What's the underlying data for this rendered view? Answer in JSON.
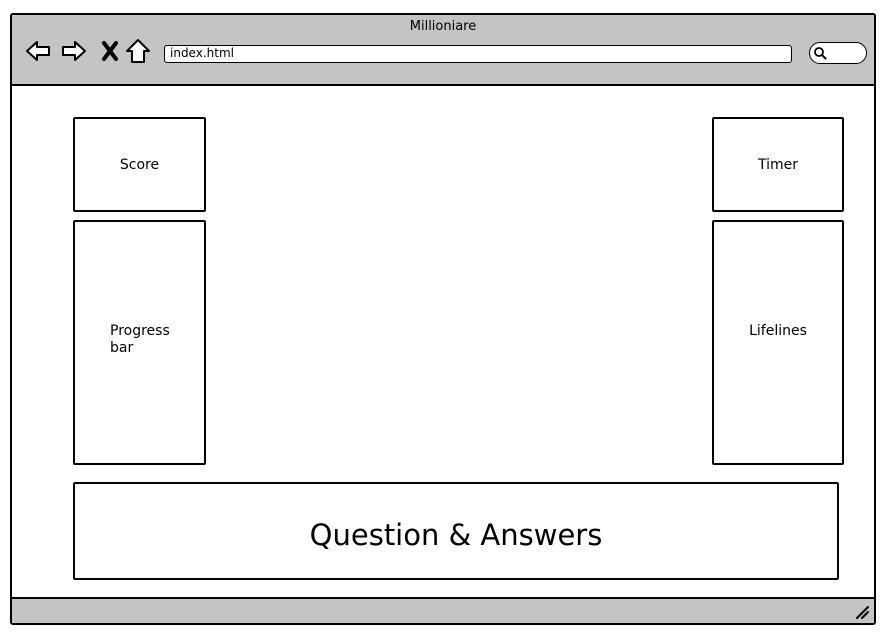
{
  "window": {
    "title": "Millioniare"
  },
  "toolbar": {
    "back_icon": "back-arrow-icon",
    "forward_icon": "forward-arrow-icon",
    "stop_icon": "close-x-icon",
    "home_icon": "home-icon",
    "address": "index.html",
    "search_icon": "search-icon"
  },
  "panels": {
    "score": "Score",
    "timer": "Timer",
    "progress": "Progress bar",
    "lifelines": "Lifelines",
    "qa": "Question & Answers"
  },
  "statusbar": {
    "resize_icon": "resize-grip-icon"
  }
}
